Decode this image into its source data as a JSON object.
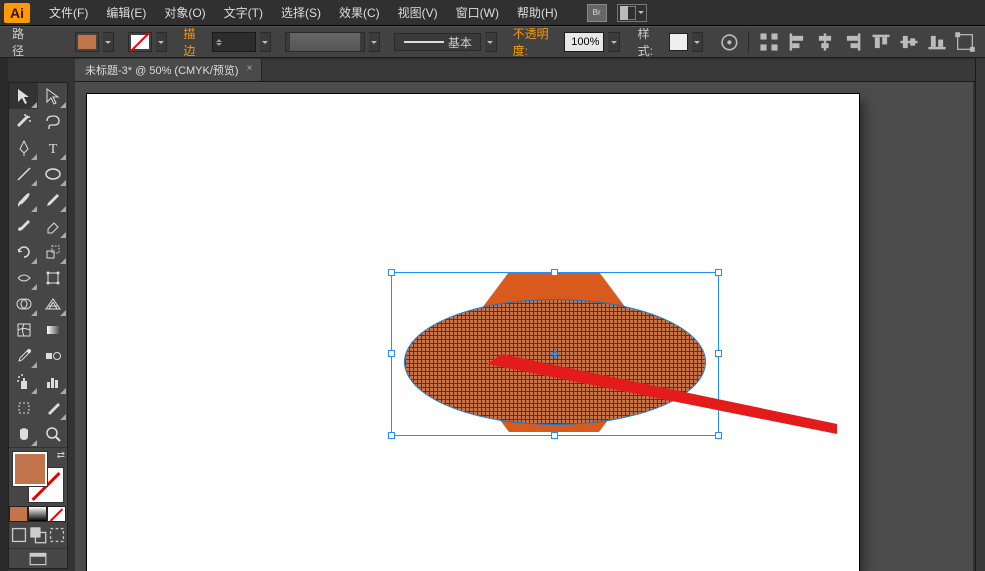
{
  "app": {
    "logo": "Ai"
  },
  "menu": {
    "file": "文件(F)",
    "edit": "编辑(E)",
    "object": "对象(O)",
    "type": "文字(T)",
    "select": "选择(S)",
    "effect": "效果(C)",
    "view": "视图(V)",
    "window": "窗口(W)",
    "help": "帮助(H)",
    "bridge": "Br"
  },
  "optbar": {
    "selection_label": "路径",
    "fill_color": "#c2744c",
    "stroke_label": "描边",
    "stroke_weight": "",
    "profile_label": "基本",
    "opacity_label": "不透明度:",
    "opacity_value": "100%",
    "style_label": "样式:"
  },
  "document": {
    "tab_title": "未标题-3* @ 50% (CMYK/预览)"
  },
  "colors": {
    "accent": "#ff9a00",
    "shape_fill": "#d85a1d",
    "ellipse_fill": "#c7734a",
    "selection": "#1e90ff",
    "annotation": "#e41b1b"
  }
}
